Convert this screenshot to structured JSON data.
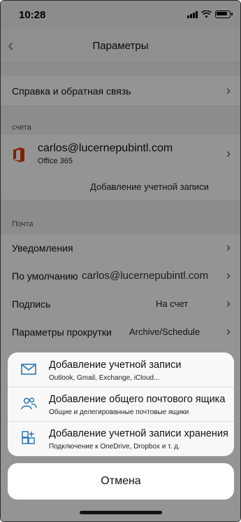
{
  "status_bar": {
    "time": "10:28"
  },
  "nav": {
    "title": "Параметры"
  },
  "help_row": {
    "label": "Справка и обратная связь"
  },
  "accounts": {
    "section_label": "счета",
    "email": "carlos@lucernepubintl.com",
    "account_type": "Office 365",
    "add_account_label": "Добавление учетной записи"
  },
  "mail": {
    "section_label": "Почта",
    "notifications_label": "Уведомления",
    "default_label": "По умолчанию",
    "default_value": "carlos@lucernepubintl.com",
    "signature_label": "Подпись",
    "signature_value": "На счет",
    "swipe_label": "Параметры прокрутки",
    "swipe_value": "Archive/Schedule"
  },
  "action_sheet": {
    "items": [
      {
        "title": "Добавление учетной записи",
        "subtitle": "Outlook, Gmail, Exchange, iCloud...",
        "icon": "mail-icon"
      },
      {
        "title": "Добавление общего почтового ящика",
        "subtitle": "Общие и делегированные почтовые ящики",
        "icon": "shared-mailbox-icon"
      },
      {
        "title": "Добавление учетной записи хранения",
        "subtitle": "Подключение к OneDrive, Dropbox и т. д.",
        "icon": "storage-add-icon"
      }
    ],
    "cancel_label": "Отмена"
  },
  "colors": {
    "accent": "#1f6fb3",
    "office_red": "#d83b01"
  }
}
